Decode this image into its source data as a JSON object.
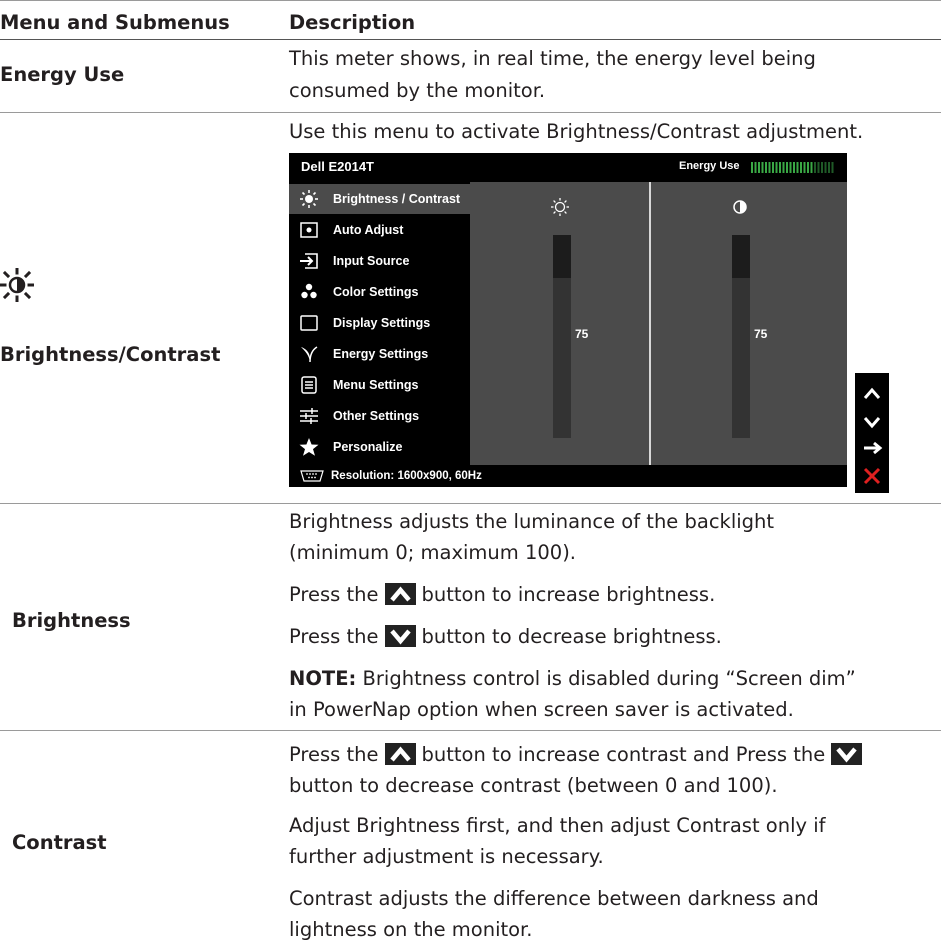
{
  "table": {
    "headers": [
      "Menu and Submenus",
      "Description"
    ],
    "energy_use": {
      "label": "Energy Use",
      "desc": [
        "This meter shows, in real time, the energy level being",
        "consumed by the monitor."
      ]
    },
    "brightness_contrast": {
      "label": "Brightness/Contrast",
      "desc": "Use this menu to activate Brightness/Contrast adjustment."
    },
    "brightness": {
      "label": "Brightness",
      "desc_lines": [
        "Brightness adjusts the luminance of the backlight",
        "(minimum 0; maximum 100)."
      ],
      "press_up_pre": "Press the",
      "press_up_post": "button to increase brightness.",
      "press_down_pre": "Press the",
      "press_down_post": "button to decrease brightness.",
      "note_label": "NOTE:",
      "note_line1": "Brightness control is disabled during “Screen dim”",
      "note_line2": "in PowerNap option when screen saver is activated."
    },
    "contrast": {
      "label": "Contrast",
      "l1_pre": "Press the",
      "l1_mid": "button to increase contrast and Press the",
      "l2": "button to decrease contrast (between 0 and 100).",
      "p2": [
        "Adjust Brightness first, and then adjust Contrast only if",
        "further adjustment is necessary."
      ],
      "p3": [
        "Contrast adjusts the difference between darkness and",
        "lightness on the monitor."
      ]
    }
  },
  "osd": {
    "model": "Dell E2014T",
    "energy_label": "Energy Use",
    "menu_items": [
      {
        "label": "Brightness / Contrast",
        "icon": "sun-icon"
      },
      {
        "label": "Auto Adjust",
        "icon": "auto-adjust-icon"
      },
      {
        "label": "Input Source",
        "icon": "input-source-icon"
      },
      {
        "label": "Color Settings",
        "icon": "color-dots-icon"
      },
      {
        "label": "Display Settings",
        "icon": "display-rect-icon"
      },
      {
        "label": "Energy Settings",
        "icon": "leaf-icon"
      },
      {
        "label": "Menu Settings",
        "icon": "menu-list-icon"
      },
      {
        "label": "Other Settings",
        "icon": "sliders-icon"
      },
      {
        "label": "Personalize",
        "icon": "star-icon"
      }
    ],
    "brightness_value": "75",
    "contrast_value": "75",
    "brightness_level": 0.75,
    "contrast_level": 0.75,
    "resolution": "Resolution: 1600x900, 60Hz"
  },
  "colors": {
    "osd_bg": "#4b4b4b",
    "menu_bg": "#000000",
    "energy_green": "#3aa845",
    "close_red": "#e02020"
  }
}
